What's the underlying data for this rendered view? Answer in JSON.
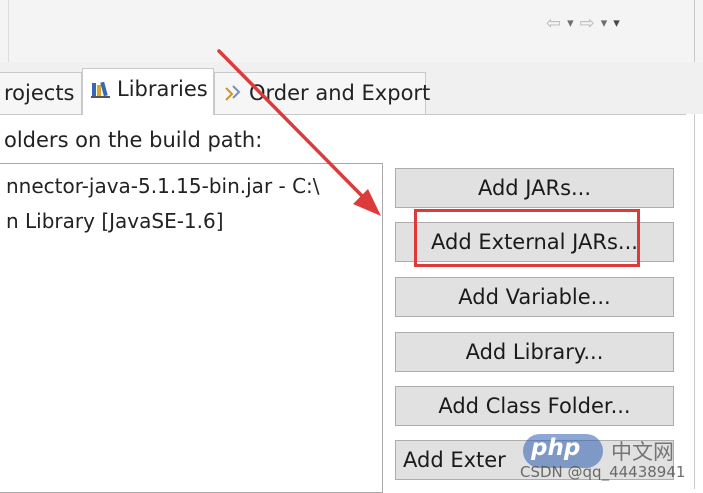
{
  "toolbar": {
    "back_icon": "⇦",
    "forward_icon": "⇨",
    "dropdown_icon": "▾",
    "menu_icon": "▾"
  },
  "tabs": {
    "projects": "rojects",
    "libraries": "Libraries",
    "order": "Order and Export"
  },
  "panel": {
    "build_path_label": "olders on the build path:",
    "items": [
      "nnector-java-5.1.15-bin.jar - C:\\",
      "n Library [JavaSE-1.6]"
    ]
  },
  "buttons": {
    "add_jars": "Add JARs...",
    "add_external_jars": "Add External JARs...",
    "add_variable": "Add Variable...",
    "add_library": "Add Library...",
    "add_class_folder": "Add Class Folder...",
    "add_external_partial": "Add Exter"
  },
  "watermark": {
    "logo": "php",
    "cn": "中文网",
    "csdn": "CSDN @qq_44438941"
  },
  "colors": {
    "highlight": "#dd3b3b",
    "arrow": "#dd3b3b"
  }
}
